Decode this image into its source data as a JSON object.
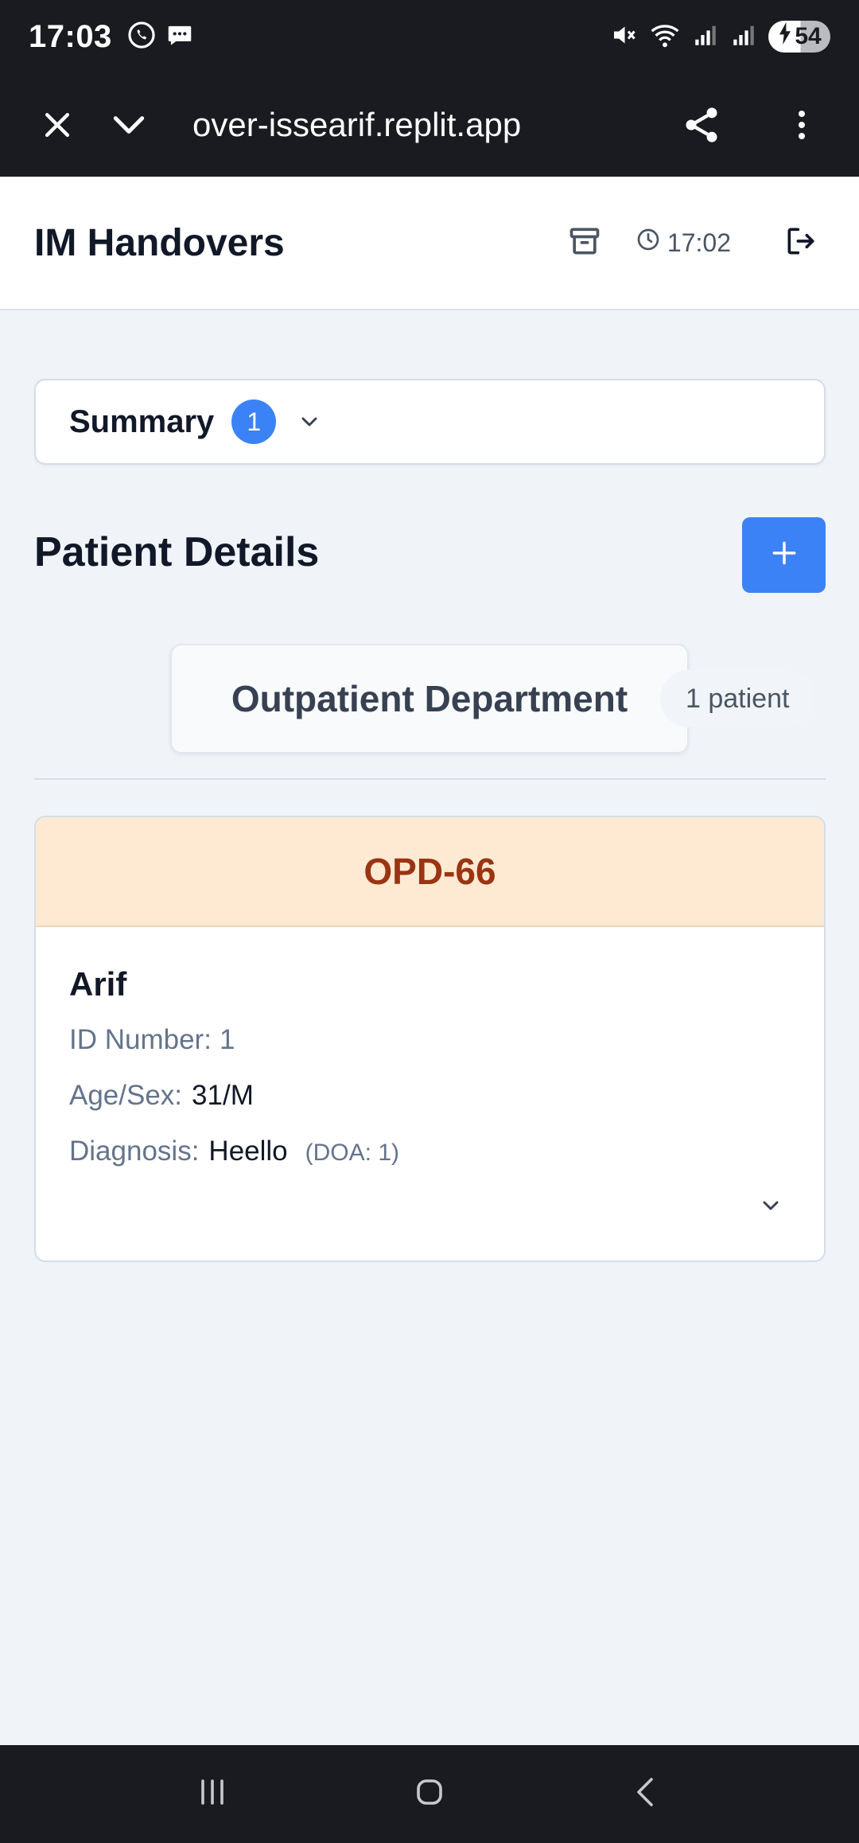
{
  "status_bar": {
    "time": "17:03",
    "battery": "54",
    "icons": [
      "viber-icon",
      "chat-bubble-icon",
      "mute-icon",
      "wifi-icon",
      "signal-icon",
      "signal-icon",
      "battery-charging-icon"
    ]
  },
  "browser": {
    "url": "over-issearif.replit.app",
    "icons": [
      "close-icon",
      "chevron-down-icon",
      "share-icon",
      "more-vertical-icon"
    ]
  },
  "header": {
    "title": "IM Handovers",
    "time": "17:02",
    "icons": [
      "archive-icon",
      "clock-icon",
      "logout-icon"
    ]
  },
  "summary": {
    "label": "Summary",
    "count": "1"
  },
  "patient_details": {
    "title": "Patient Details",
    "add_icon": "plus-icon",
    "department": {
      "name": "Outpatient Department",
      "count_label": "1 patient"
    }
  },
  "patients": [
    {
      "bed": "OPD-66",
      "name": "Arif",
      "id_label": "ID Number:",
      "id_value": "1",
      "agesex_label": "Age/Sex:",
      "agesex_value": "31/M",
      "diagnosis_label": "Diagnosis:",
      "diagnosis_value": "Heello",
      "doa": "(DOA: 1)"
    }
  ],
  "colors": {
    "accent": "#3b82f6",
    "bed_header_bg": "#feead3",
    "bed_header_text": "#9a3412",
    "page_bg": "#f0f4f9",
    "system_bar_bg": "#1a1b20"
  }
}
